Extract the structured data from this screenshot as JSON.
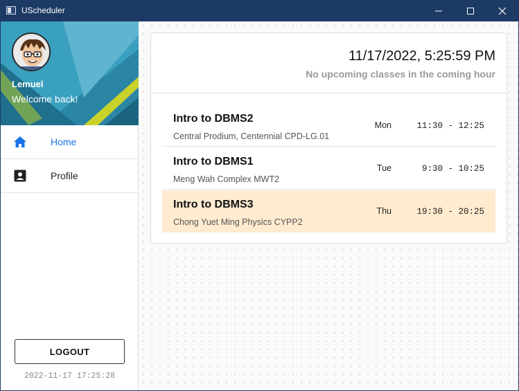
{
  "window": {
    "title": "UScheduler",
    "controls": {
      "minimize": "–",
      "maximize": "☐",
      "close": "✕"
    }
  },
  "sidebar": {
    "user_name": "Lemuel",
    "welcome": "Welcome back!",
    "nav": [
      {
        "label": "Home",
        "icon": "home-icon",
        "active": true
      },
      {
        "label": "Profile",
        "icon": "profile-card-icon",
        "active": false
      }
    ],
    "logout_label": "LOGOUT",
    "timestamp": "2022-11-17 17:25:28"
  },
  "main": {
    "clock": "11/17/2022, 5:25:59 PM",
    "next_info": "No upcoming classes in the coming hour",
    "classes": [
      {
        "title": "Intro to DBMS2",
        "location": "Central Prodium, Centennial CPD-LG.01",
        "day": "Mon",
        "time": "11:30 - 12:25",
        "highlighted": false
      },
      {
        "title": "Intro to DBMS1",
        "location": "Meng Wah Complex MWT2",
        "day": "Tue",
        "time": "9:30 - 10:25",
        "highlighted": false
      },
      {
        "title": "Intro to DBMS3",
        "location": "Chong Yuet Ming Physics CYPP2",
        "day": "Thu",
        "time": "19:30 - 20:25",
        "highlighted": true
      }
    ]
  },
  "colors": {
    "titlebar": "#1c3a63",
    "accent": "#1a73e8",
    "highlight_row": "#feebd0"
  }
}
